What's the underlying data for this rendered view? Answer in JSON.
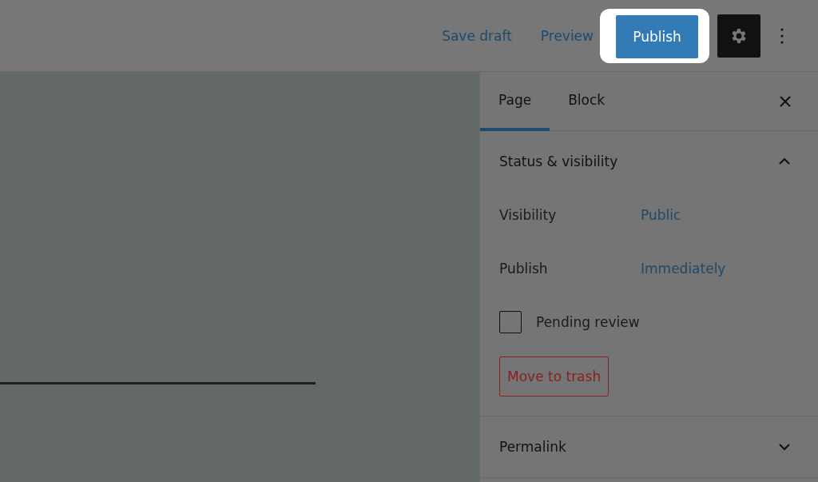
{
  "header": {
    "save_draft": "Save draft",
    "preview": "Preview",
    "publish": "Publish",
    "settings_active": true
  },
  "sidebar": {
    "tabs": [
      {
        "label": "Page",
        "selected": true
      },
      {
        "label": "Block",
        "selected": false
      }
    ],
    "panels": [
      {
        "title": "Status & visibility",
        "expanded": true,
        "rows": [
          {
            "label": "Visibility",
            "value": "Public"
          },
          {
            "label": "Publish",
            "value": "Immediately"
          }
        ],
        "checkbox": {
          "label": "Pending review",
          "checked": false
        },
        "trash": "Move to trash"
      },
      {
        "title": "Permalink",
        "expanded": false
      }
    ]
  }
}
